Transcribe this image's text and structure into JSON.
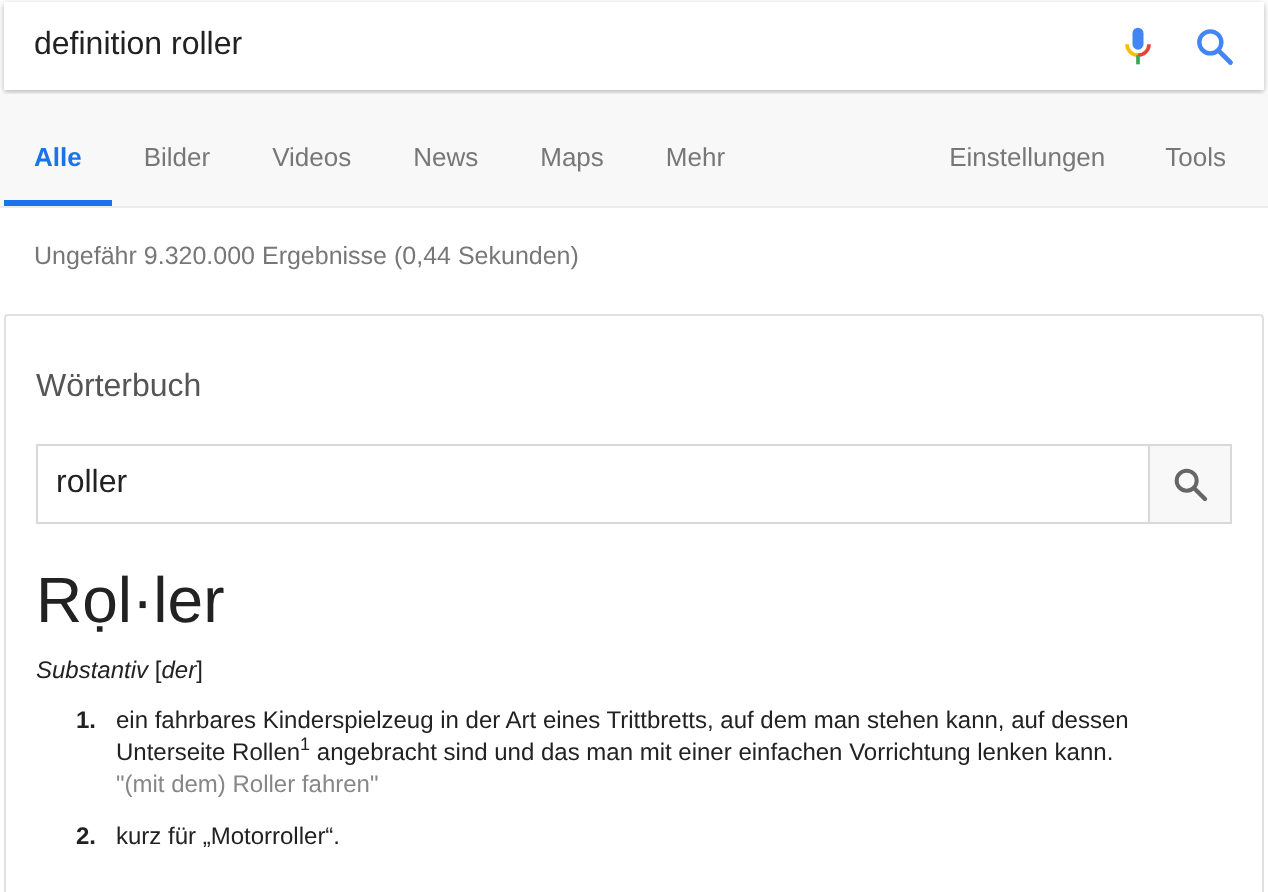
{
  "search": {
    "value": "definition roller"
  },
  "tabs": [
    {
      "label": "Alle",
      "selected": true
    },
    {
      "label": "Bilder",
      "selected": false
    },
    {
      "label": "Videos",
      "selected": false
    },
    {
      "label": "News",
      "selected": false
    },
    {
      "label": "Maps",
      "selected": false
    },
    {
      "label": "Mehr",
      "selected": false
    }
  ],
  "tools": [
    "Einstellungen",
    "Tools"
  ],
  "result_stats": "Ungefähr 9.320.000 Ergebnisse (0,44 Sekunden)",
  "dictionary": {
    "title": "Wörterbuch",
    "search_value": "roller",
    "headword": "Rọl·ler",
    "grammar": "*Substantiv* [*der*]",
    "definitions": [
      {
        "number": "1.",
        "text": "ein fahrbares Kinderspielzeug in der Art eines Trittbretts, auf dem man stehen kann, auf dessen Unterseite Rollen$^{1}$ angebracht sind und das man mit einer einfachen Vorrichtung lenken kann.",
        "example": "\"(mit dem) Roller fahren\""
      },
      {
        "number": "2.",
        "text": "kurz für „Motorroller“."
      }
    ]
  }
}
